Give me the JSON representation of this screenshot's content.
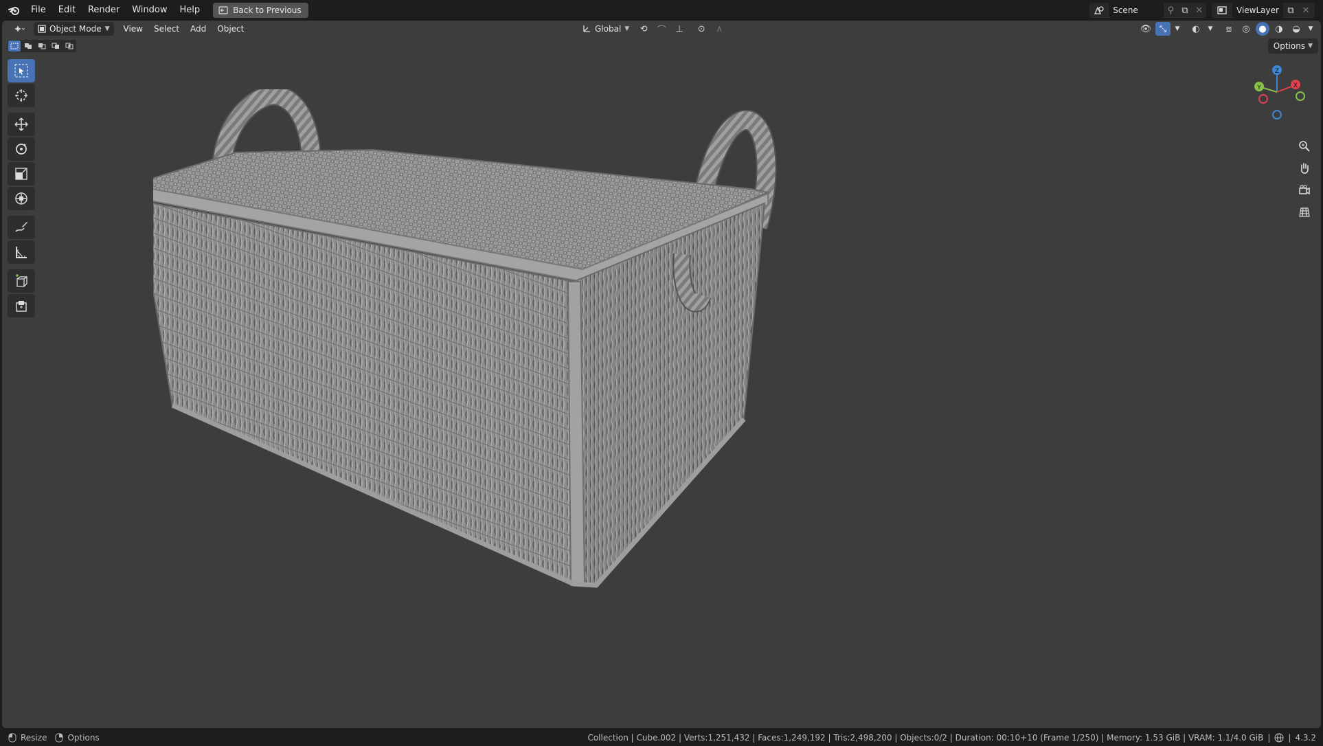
{
  "menubar": {
    "items": [
      "File",
      "Edit",
      "Render",
      "Window",
      "Help"
    ],
    "back_button": "Back to Previous"
  },
  "scene": {
    "name": "Scene"
  },
  "view_layer": {
    "name": "ViewLayer"
  },
  "viewport_header": {
    "mode": "Object Mode",
    "menus": [
      "View",
      "Select",
      "Add",
      "Object"
    ],
    "orientation": "Global",
    "options_label": "Options"
  },
  "gizmo": {
    "z": "Z",
    "y": "Y",
    "x": "X"
  },
  "toolbar": {
    "tools": [
      "select-box",
      "cursor",
      "move",
      "rotate",
      "scale",
      "transform",
      "annotate",
      "measure",
      "add-cube",
      "add-primitive"
    ],
    "active_tool": "select-box"
  },
  "colors": {
    "accent": "#4772b3",
    "viewport_bg": "#3d3d3d",
    "axis_x": "#e0404b",
    "axis_y": "#8ac34a",
    "axis_z": "#3e87d6"
  },
  "statusbar": {
    "left_1": "Resize",
    "left_2": "Options",
    "right": "Collection | Cube.002 | Verts:1,251,432 | Faces:1,249,192 | Tris:2,498,200 | Objects:0/2 | Duration: 00:10+10 (Frame 1/250) | Memory: 1.53 GiB | VRAM: 1.1/4.0 GiB",
    "version": "4.3.2"
  }
}
